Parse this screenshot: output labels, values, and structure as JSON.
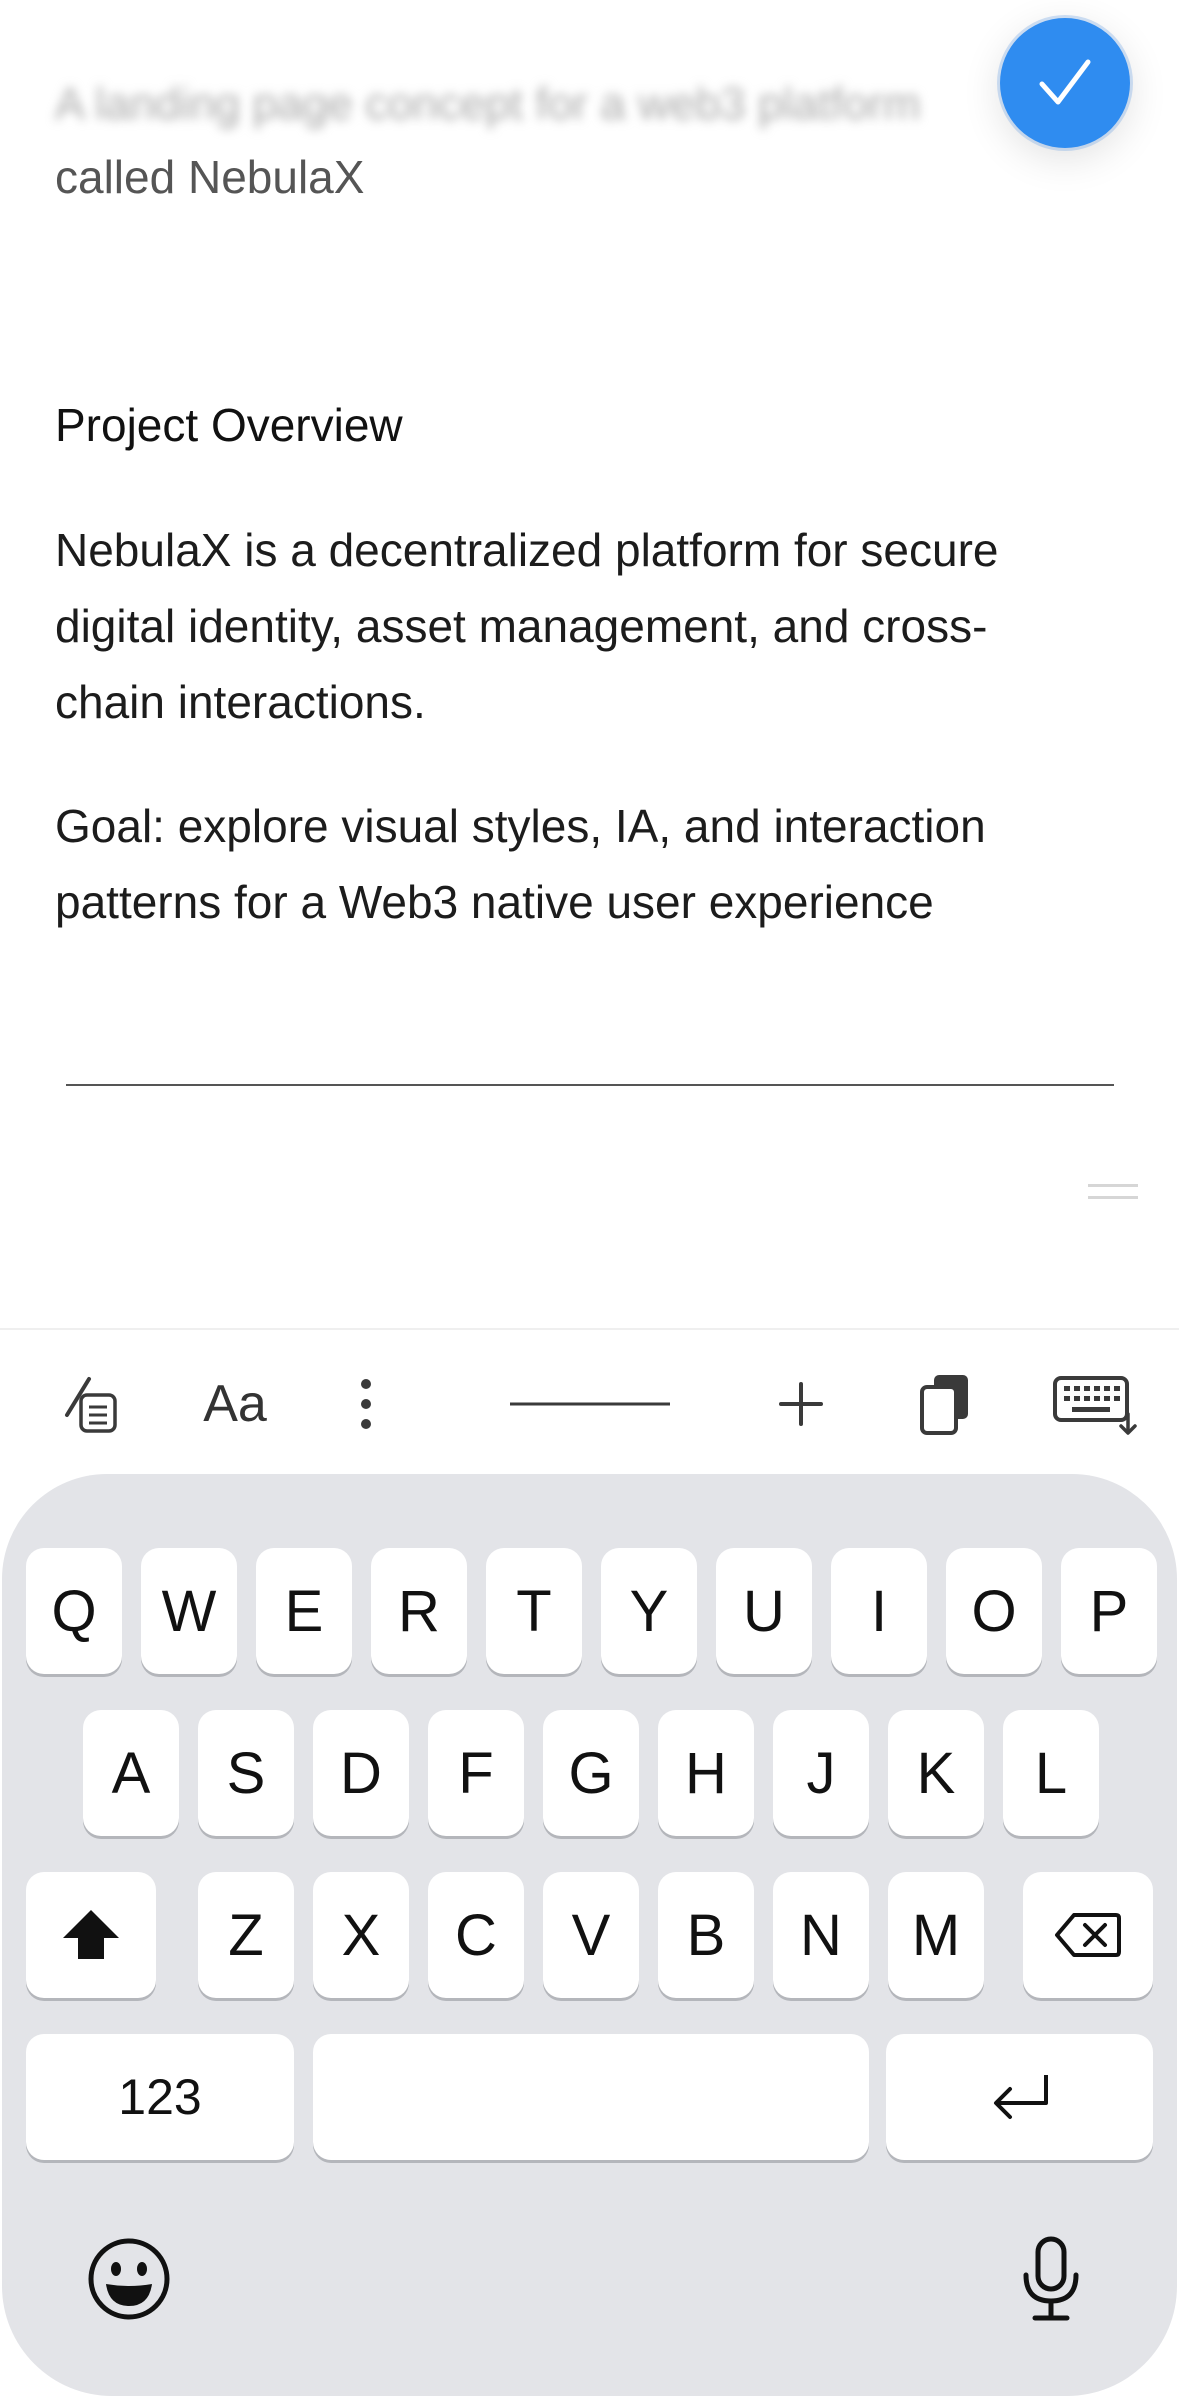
{
  "note": {
    "title_line1": "A landing page concept for a web3 platform",
    "title_line2": "called NebulaX",
    "heading": "Project Overview",
    "paragraph1": "NebulaX is a decentralized platform for secure digital identity, asset management, and cross-chain interactions.",
    "paragraph2": "Goal: explore visual styles, IA, and interaction patterns for a Web3 native user experience"
  },
  "done_button": {
    "icon": "checkmark-icon",
    "color": "#2f8cf0"
  },
  "toolbar": {
    "items": [
      {
        "name": "checklist-style-icon"
      },
      {
        "name": "text-format-button",
        "label": "Aa"
      },
      {
        "name": "more-icon"
      },
      {
        "name": "divider-line-icon"
      },
      {
        "name": "plus-icon"
      },
      {
        "name": "clipboard-icon"
      },
      {
        "name": "keyboard-dismiss-icon"
      }
    ]
  },
  "keyboard": {
    "row1": [
      "Q",
      "W",
      "E",
      "R",
      "T",
      "Y",
      "U",
      "I",
      "O",
      "P"
    ],
    "row2": [
      "A",
      "S",
      "D",
      "F",
      "G",
      "H",
      "J",
      "K",
      "L"
    ],
    "row3": [
      "Z",
      "X",
      "C",
      "V",
      "B",
      "N",
      "M"
    ],
    "numbers_label": "123",
    "icons": {
      "shift": "shift-icon",
      "delete": "delete-icon",
      "return": "return-icon",
      "emoji": "emoji-icon",
      "mic": "microphone-icon"
    }
  }
}
